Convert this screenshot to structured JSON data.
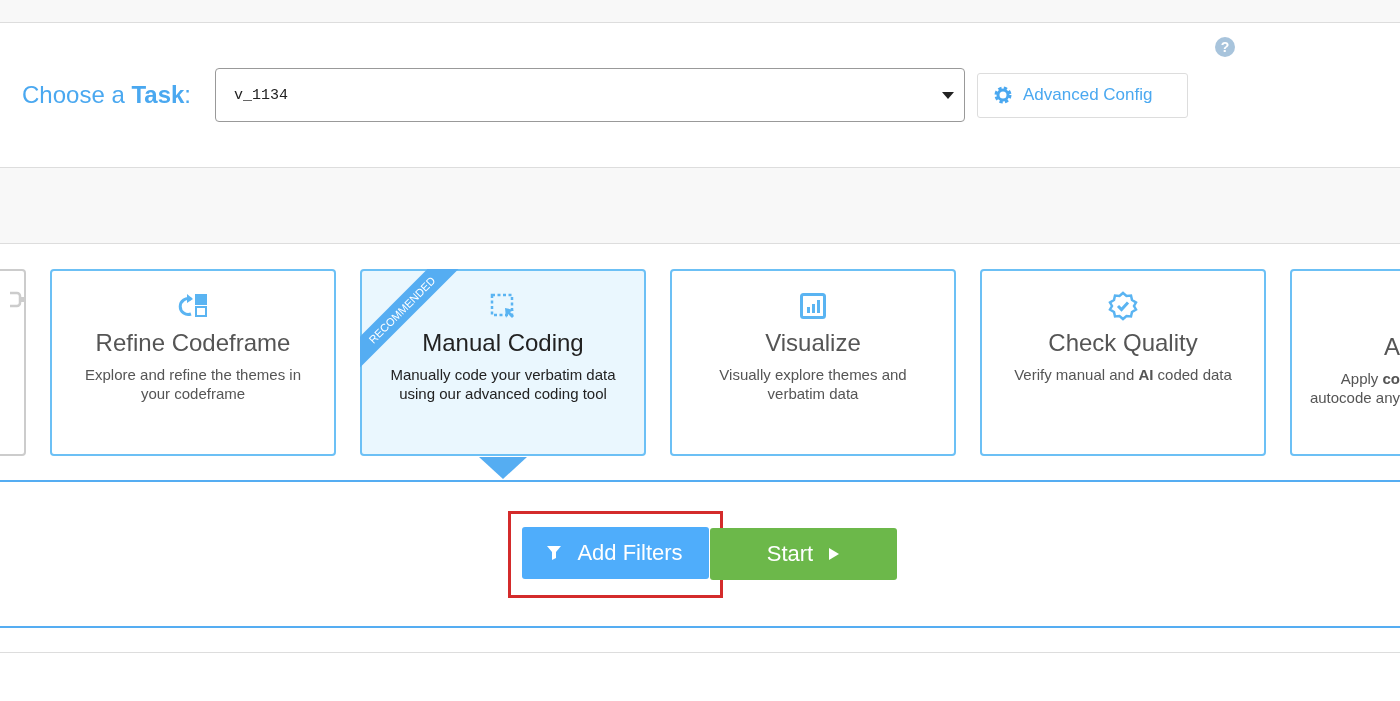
{
  "task_selector": {
    "label": "Choose a **Task**:",
    "value": "v_1134",
    "config_button": "Advanced Config",
    "help": "?"
  },
  "cards": [
    {
      "kind": "edge-left",
      "selected": false
    },
    {
      "kind": "full",
      "selected": false,
      "title": "Refine Codeframe",
      "description": "Explore and refine the themes in\nyour codeframe"
    },
    {
      "kind": "full",
      "selected": true,
      "title": "Manual Coding",
      "description": "Manually code your verbatim data\nusing our advanced coding tool",
      "ribbon": "RECOMMENDED"
    },
    {
      "kind": "full",
      "selected": false,
      "title": "Visualize",
      "description": "Visually explore themes and\nverbatim data"
    },
    {
      "kind": "full",
      "selected": false,
      "title": "Check Quality",
      "description": "Verify manual and **AI** coded data"
    },
    {
      "kind": "edge-right",
      "selected": false,
      "title": "A",
      "description": "Apply **co**\nautocode any"
    }
  ],
  "actions": [
    {
      "kind": "filter",
      "label": "Add Filters",
      "highlighted": true
    },
    {
      "kind": "start",
      "label": "Start",
      "highlighted": false
    }
  ]
}
